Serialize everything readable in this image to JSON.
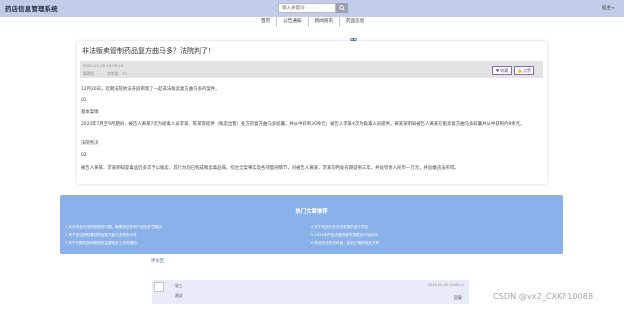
{
  "app": {
    "title": "药店信息管理系统"
  },
  "search": {
    "placeholder": "输入关键词"
  },
  "user_menu": {
    "label": "宿主"
  },
  "nav": {
    "items": [
      "首页",
      "公告通知",
      "新闻资讯",
      "药品信息"
    ]
  },
  "article": {
    "title": "非法贩卖管制药品复方曲马多？法院判了！",
    "time": "2024-05-18 15:09:24",
    "author": "管理员",
    "views": "浏览量：72",
    "collect_label": "收藏",
    "like_label": "点赞",
    "paragraphs": [
      "12月20日，近期法院依法开庭审理了一起非法贩卖复方曲马多的案件。",
      "01",
      "基本案情",
      "2023年7月至9月期间，被告人黄某7次为吸毒人员李某、陈某等提供（贩卖出售）处方药复方曲马多胶囊，并从中获利30余元；被告人李某4次为吸毒人员提供，黄某某明知被告人黄某在贩卖复方曲马多胶囊并从中获利约9余元。",
      "法院判决",
      "02",
      "被告人黄某、李某明知是毒品仍多次予以贩卖，其行为均已构成贩卖毒品罪。综合全案事实及各项量刑情节，对被告人黄某、李某均判处有期徒刑三年，并处罚金人民币一万元，并追缴违法所得。"
    ]
  },
  "hot": {
    "title": "热门文章推荐",
    "items": [
      "1  北京药品引用药品相关问题，新增违法条例介绍及处罚规定",
      "2  男子非法获取管制药品复方曲马多获刑半年",
      "3  关于开展药品网络销售监督检查工作的通知",
      "4  关于药品行业安全发展的若干意见",
      "5  2024年药品流通领域专项整治行动启动",
      "6  药品安全知识科普：如何正确使用处方药"
    ]
  },
  "comments": {
    "link_label": "评论区",
    "items": [
      {
        "name": "张三",
        "time": "2024-05-18 15:08:12",
        "content": "测试",
        "reply_label": "回复"
      }
    ]
  },
  "watermark": {
    "text": "CSDN @vx2_CXKF10088"
  }
}
